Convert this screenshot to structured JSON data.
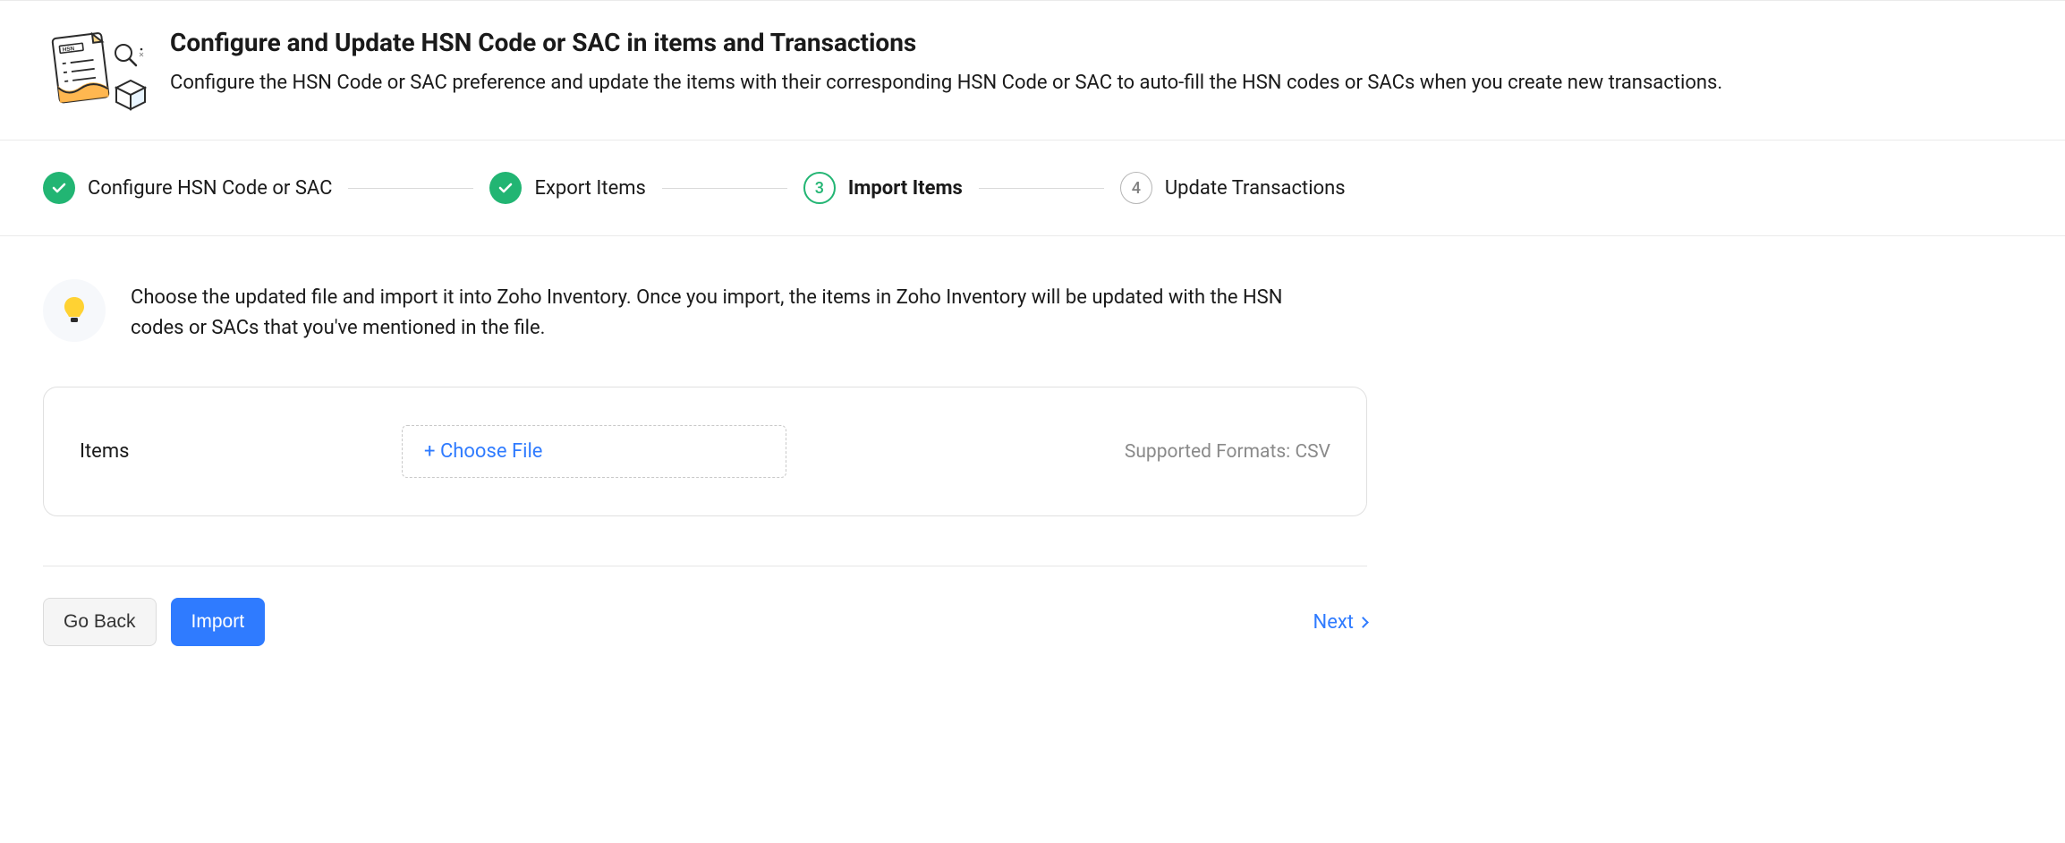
{
  "header": {
    "title": "Configure and Update HSN Code or SAC in items and Transactions",
    "description": "Configure the HSN Code or SAC preference and update the items with their corresponding HSN Code or SAC to auto-fill the HSN codes or SACs when you create new transactions.",
    "icon_text": "HSN"
  },
  "stepper": {
    "steps": [
      {
        "label": "Configure HSN Code or SAC",
        "status": "done"
      },
      {
        "label": "Export Items",
        "status": "done"
      },
      {
        "number": "3",
        "label": "Import Items",
        "status": "current"
      },
      {
        "number": "4",
        "label": "Update Transactions",
        "status": "pending"
      }
    ]
  },
  "content": {
    "hint": "Choose the updated file and import it into Zoho Inventory. Once you import, the items in Zoho Inventory will be updated with the HSN codes or SACs that you've mentioned in the file.",
    "upload": {
      "label": "Items",
      "choose_file": "+ Choose File",
      "supported": "Supported Formats: CSV"
    }
  },
  "footer": {
    "go_back": "Go Back",
    "import": "Import",
    "next": "Next"
  }
}
